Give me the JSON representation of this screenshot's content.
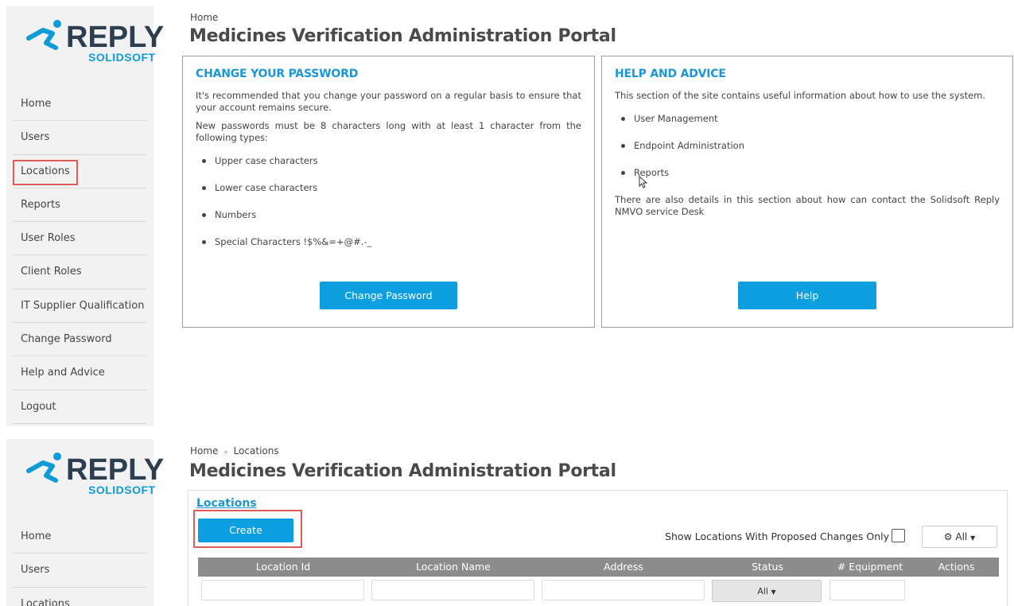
{
  "logo": {
    "brand": "REPLY",
    "sub": "SOLIDSOFT"
  },
  "nav": {
    "items": [
      "Home",
      "Users",
      "Locations",
      "Reports",
      "User Roles",
      "Client Roles",
      "IT Supplier Qualification",
      "Change Password",
      "Help and Advice",
      "Logout"
    ]
  },
  "screen1": {
    "breadcrumb": "Home",
    "title": "Medicines Verification Administration Portal",
    "password_card": {
      "heading": "CHANGE YOUR PASSWORD",
      "p1": "It's recommended that you change your password on a regular basis to ensure that your account remains secure.",
      "p2": "New passwords must be 8 characters long with at least 1 character from the following types:",
      "items": [
        "Upper case characters",
        "Lower case characters",
        "Numbers",
        "Special Characters !$%&=+@#.-_"
      ],
      "button": "Change Password"
    },
    "help_card": {
      "heading": "HELP AND ADVICE",
      "p1": "This section of the site contains useful information about how to use the system.",
      "items": [
        "User Management",
        "Endpoint Administration",
        "Reports"
      ],
      "p2": "There are also details in this section about how can contact the Solidsoft Reply NMVO service Desk",
      "button": "Help"
    }
  },
  "screen2": {
    "breadcrumb_home": "Home",
    "breadcrumb_sep": "»",
    "breadcrumb_current": "Locations",
    "title": "Medicines Verification Administration Portal",
    "locations": {
      "heading": "Locations",
      "create_button": "Create",
      "show_label": "Show Locations With Proposed Changes Only",
      "all_button": "All",
      "columns": [
        "Location Id",
        "Location Name",
        "Address",
        "Status",
        "# Equipment",
        "Actions"
      ],
      "status_filter": "All"
    }
  },
  "colors": {
    "accent": "#0e9fe0",
    "highlight": "#e05a5a",
    "navy": "#2c3e4f"
  }
}
